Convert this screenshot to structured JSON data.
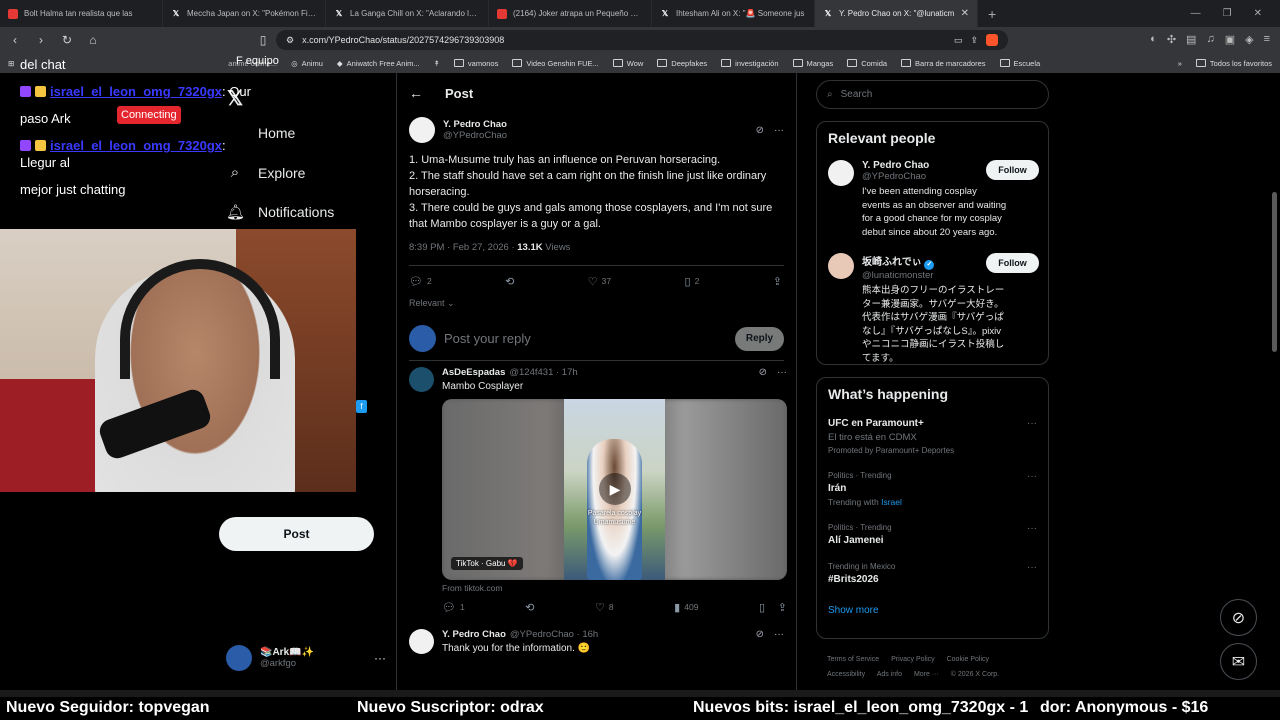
{
  "browser": {
    "tabs": [
      {
        "title": "Bolt Halma tan realista que las",
        "favicon": "yt",
        "active": false
      },
      {
        "title": "Meccha Japan on X: \"Pokémon Fit - F",
        "favicon": "x",
        "active": false
      },
      {
        "title": "La Ganga Chill on X: \"Aclarando la si",
        "favicon": "x",
        "active": false
      },
      {
        "title": "(2164) Joker atrapa un Pequeño Poke",
        "favicon": "yt",
        "active": false
      },
      {
        "title": "Ihtesham Ali on X: \"🚨 Someone jus",
        "favicon": "x",
        "active": false
      },
      {
        "title": "Y. Pedro Chao on X: \"@lunaticm",
        "favicon": "x",
        "active": true
      }
    ],
    "url": "x.com/YPedroChao/status/2027574296739303908",
    "bookmarks": [
      {
        "label": "Animu",
        "type": "link"
      },
      {
        "label": "Aniwatch Free Anim...",
        "type": "link"
      },
      {
        "label": "vamonos",
        "type": "folder"
      },
      {
        "label": "Video Genshin FUE...",
        "type": "folder"
      },
      {
        "label": "Wow",
        "type": "folder"
      },
      {
        "label": "Deepfakes",
        "type": "folder"
      },
      {
        "label": "investigación",
        "type": "folder"
      },
      {
        "label": "Mangas",
        "type": "folder"
      },
      {
        "label": "Comida",
        "type": "folder"
      },
      {
        "label": "Barra de marcadores",
        "type": "folder"
      },
      {
        "label": "Escuela",
        "type": "folder"
      }
    ],
    "bookmarks_overlap": "anime online...",
    "all_bookmarks": "Todos los favoritos"
  },
  "overlay": {
    "chat": [
      {
        "user": "",
        "text": "del chat"
      },
      {
        "user": "israel_el_leon_omg_7320gx",
        "text": ": Qur"
      },
      {
        "user": "",
        "text": "paso Ark"
      },
      {
        "user": "israel_el_leon_omg_7320gx",
        "text": ": Llegur al"
      },
      {
        "user": "",
        "text": "mejor just chatting"
      }
    ],
    "connecting": "Connecting",
    "equipo": "F equipo",
    "ticker": {
      "follower": "Nuevo Seguidor: topvegan",
      "subscriber": "Nuevo Suscriptor: odrax",
      "bits": "Nuevos bits: israel_el_leon_omg_7320gx - 1",
      "donor": "dor: Anonymous - $16"
    }
  },
  "nav": {
    "home": "Home",
    "explore": "Explore",
    "notifications": "Notifications",
    "post_button": "Post",
    "account_name": "📚Ark📖✨",
    "account_handle": "@arkfgo"
  },
  "main": {
    "header": "Post",
    "tweet": {
      "name": "Y. Pedro Chao",
      "handle": "@YPedroChao",
      "lines": [
        "1. Uma-Musume truly has an influence on Peruvan horseracing.",
        "2. The staff should have set a cam right on the finish line just like ordinary horseracing.",
        "3. There could be guys and gals among those cosplayers, and I'm not sure that Mambo cosplayer is a guy or a gal."
      ],
      "time": "8:39 PM · Feb 27, 2026 · ",
      "views_count": "13.1K",
      "views_label": " Views",
      "replies": "2",
      "likes": "37",
      "bookmarks": "2"
    },
    "relevant": "Relevant",
    "reply_placeholder": "Post your reply",
    "reply_button": "Reply",
    "replies": [
      {
        "name": "AsDeEspadas",
        "handle": "@124f431 · 17h",
        "text": "Mambo Cosplayer",
        "media_caption": "Pasarela cosplay\nUmamusume",
        "media_source": "TikTok · Gabu 💔",
        "from": "From tiktok.com",
        "reply_count": "1",
        "like_count": "8",
        "views": "409"
      },
      {
        "name": "Y. Pedro Chao",
        "handle": "@YPedroChao · 16h",
        "text": "Thank you for the information. 🙂"
      }
    ]
  },
  "sidebar": {
    "search_placeholder": "Search",
    "relevant_title": "Relevant people",
    "people": [
      {
        "name": "Y. Pedro Chao",
        "handle": "@YPedroChao",
        "bio": "I've been attending cosplay events as an observer and waiting for a good chance for my cosplay debut since about 20 years ago.",
        "follow": "Follow",
        "verified": false
      },
      {
        "name": "坂崎ふれでぃ",
        "handle": "@lunaticmonster",
        "bio": "熊本出身のフリーのイラストレーター兼漫画家。サバゲー大好き。代表作はサバゲ漫画『サバゲっぱなし』『サバゲっぱなしS』。pixivやニコニコ静画にイラスト投稿してます。",
        "follow": "Follow",
        "verified": true
      }
    ],
    "happening_title": "What’s happening",
    "trends": [
      {
        "cat": "",
        "title": "UFC en Paramount+",
        "sub": "El tiro está en CDMX",
        "sub2": "Promoted by Paramount+ Deportes"
      },
      {
        "cat": "Politics · Trending",
        "title": "Irán",
        "sub": "Trending with ",
        "hl": "Israel"
      },
      {
        "cat": "Politics · Trending",
        "title": "Alí Jamenei",
        "sub": ""
      },
      {
        "cat": "Trending in Mexico",
        "title": "#Brits2026",
        "sub": ""
      }
    ],
    "show_more": "Show more",
    "footer": [
      "Terms of Service",
      "Privacy Policy",
      "Cookie Policy",
      "Accessibility",
      "Ads info",
      "More ···",
      "© 2026 X Corp."
    ]
  },
  "colors": {
    "accent": "#1d9bf0",
    "twitch": "#9146ff",
    "connecting": "#e4262f"
  }
}
